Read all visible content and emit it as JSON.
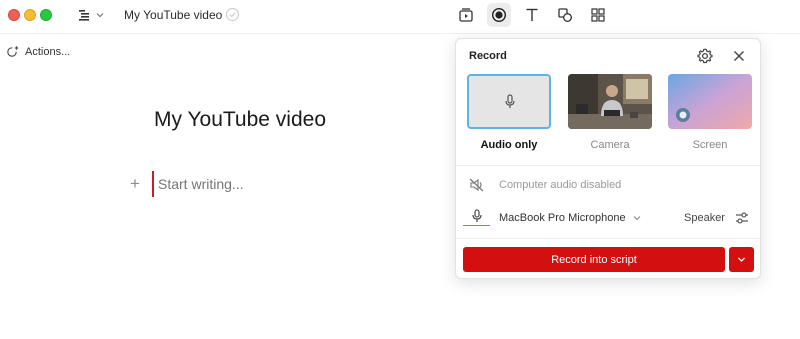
{
  "window": {
    "title": "My YouTube video"
  },
  "toolbar": {
    "tools": [
      "storyboard-icon",
      "record-icon",
      "text-icon",
      "shapes-icon",
      "grid-icon"
    ],
    "active": "record-icon"
  },
  "actions": {
    "label": "Actions..."
  },
  "document": {
    "heading": "My YouTube video",
    "placeholder": "Start writing..."
  },
  "record_panel": {
    "title": "Record",
    "sources": [
      {
        "label": "Audio only",
        "selected": true
      },
      {
        "label": "Camera",
        "selected": false
      },
      {
        "label": "Screen",
        "selected": false
      }
    ],
    "computer_audio": "Computer audio disabled",
    "microphone": "MacBook Pro Microphone",
    "speaker": "Speaker",
    "record_button": "Record into script"
  },
  "colors": {
    "accent_red": "#d30f0f",
    "selection_blue": "#5eb4e4",
    "cursor_red": "#c0202a"
  }
}
